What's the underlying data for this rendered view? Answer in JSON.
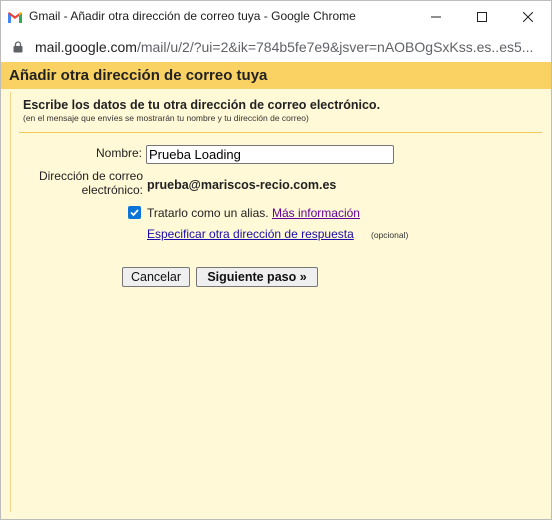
{
  "window": {
    "title": "Gmail - Añadir otra dirección de correo tuya - Google Chrome",
    "url_host": "mail.google.com",
    "url_path": "/mail/u/2/?ui=2&ik=784b5fe7e9&jsver=nAOBOgSxKss.es..es5..."
  },
  "dialog": {
    "title": "Añadir otra dirección de correo tuya",
    "subtitle": "Escribe los datos de tu otra dirección de correo electrónico.",
    "note": "(en el mensaje que envíes se mostrarán tu nombre y tu dirección de correo)",
    "name_label": "Nombre:",
    "name_value": "Prueba Loading",
    "email_label_line1": "Dirección de correo",
    "email_label_line2": "electrónico:",
    "email_value": "prueba@mariscos-recio.com.es",
    "alias_label": "Tratarlo como un alias.",
    "alias_checked": true,
    "more_info_link": "Más información",
    "reply_to_link": "Especificar otra dirección de respuesta",
    "reply_to_optional": "(opcional)",
    "cancel_button": "Cancelar",
    "next_button": "Siguiente paso »"
  },
  "colors": {
    "header_bg": "#fad163",
    "dialog_bg": "#fff9d7",
    "divider": "#f1c75a",
    "checkbox": "#0b74d9",
    "visited_link": "#660099",
    "link": "#1a0dab"
  },
  "icons": {
    "app": "gmail-icon",
    "minimize": "minimize-icon",
    "maximize": "maximize-icon",
    "close": "close-icon",
    "lock": "lock-icon",
    "checkbox": "checkmark-icon"
  }
}
